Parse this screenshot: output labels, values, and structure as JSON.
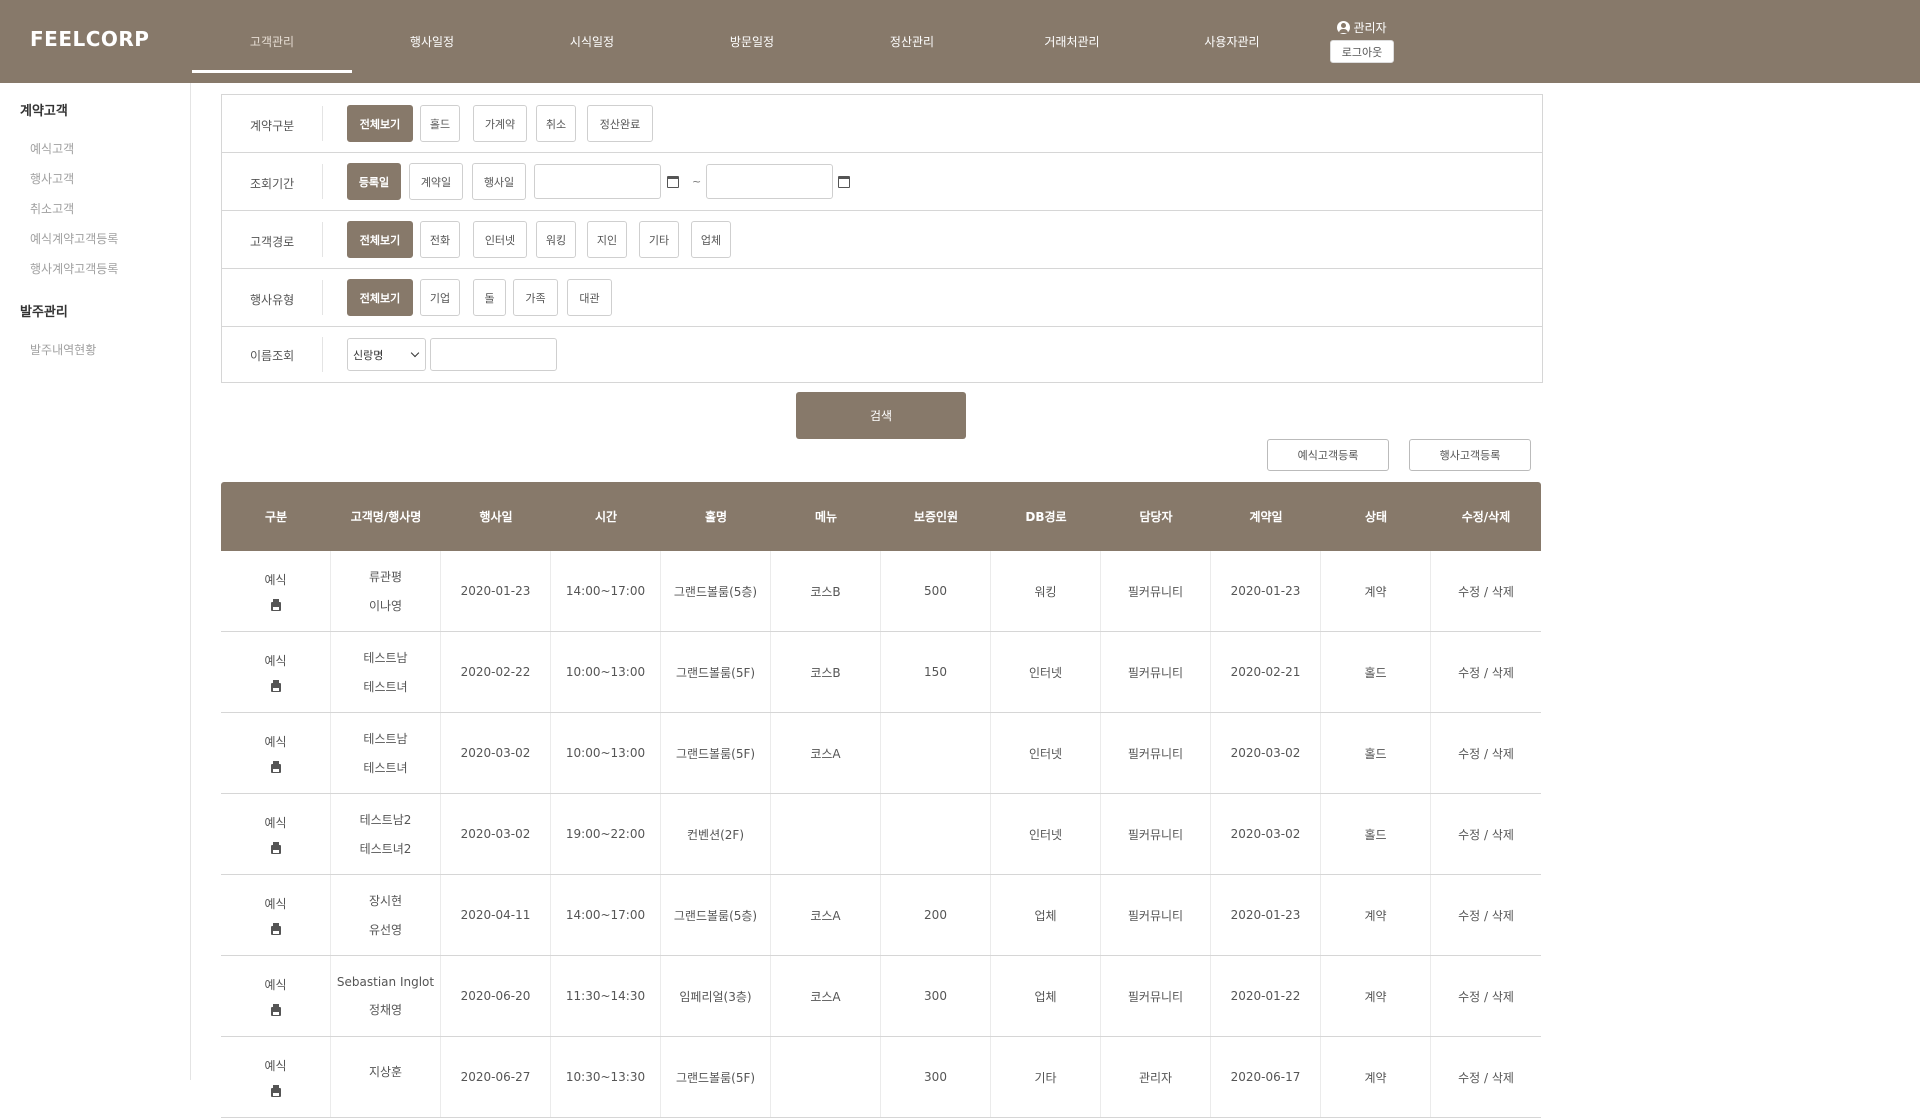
{
  "header": {
    "logo": "FEELCORP",
    "nav": [
      "고객관리",
      "행사일정",
      "시식일정",
      "방문일정",
      "정산관리",
      "거래처관리",
      "사용자관리"
    ],
    "active_nav": "고객관리",
    "user": "관리자",
    "logout": "로그아웃"
  },
  "sidebar": {
    "groups": [
      {
        "title": "계약고객",
        "items": [
          "예식고객",
          "행사고객",
          "취소고객",
          "예식계약고객등록",
          "행사계약고객등록"
        ]
      },
      {
        "title": "발주관리",
        "items": [
          "발주내역현황"
        ]
      }
    ]
  },
  "filters": {
    "contract_type": {
      "label": "계약구분",
      "options": [
        "전체보기",
        "홀드",
        "가계약",
        "취소",
        "정산완료"
      ],
      "selected": "전체보기"
    },
    "period": {
      "label": "조회기간",
      "options": [
        "등록일",
        "계약일",
        "행사일"
      ],
      "selected": "등록일",
      "from": "",
      "to": "",
      "separator": "~"
    },
    "route": {
      "label": "고객경로",
      "options": [
        "전체보기",
        "전화",
        "인터넷",
        "워킹",
        "지인",
        "기타",
        "업체"
      ],
      "selected": "전체보기"
    },
    "event_type": {
      "label": "행사유형",
      "options": [
        "전체보기",
        "기업",
        "돌",
        "가족",
        "대관"
      ],
      "selected": "전체보기"
    },
    "name_search": {
      "label": "이름조회",
      "select_value": "신랑명",
      "input_value": ""
    }
  },
  "actions": {
    "search": "검색",
    "register_wedding": "예식고객등록",
    "register_event": "행사고객등록"
  },
  "table": {
    "columns": [
      "구분",
      "고객명/행사명",
      "행사일",
      "시간",
      "홀명",
      "메뉴",
      "보증인원",
      "DB경로",
      "담당자",
      "계약일",
      "상태",
      "수정/삭제"
    ],
    "rows": [
      {
        "type": "예식",
        "name1": "류관평",
        "name2": "이나영",
        "date": "2020-01-23",
        "time": "14:00~17:00",
        "hall": "그랜드볼룸(5층)",
        "menu": "코스B",
        "guests": "500",
        "route": "워킹",
        "manager": "필커뮤니티",
        "contract_date": "2020-01-23",
        "status": "계약",
        "action": "수정 / 삭제"
      },
      {
        "type": "예식",
        "name1": "테스트남",
        "name2": "테스트녀",
        "date": "2020-02-22",
        "time": "10:00~13:00",
        "hall": "그랜드볼룸(5F)",
        "menu": "코스B",
        "guests": "150",
        "route": "인터넷",
        "manager": "필커뮤니티",
        "contract_date": "2020-02-21",
        "status": "홀드",
        "action": "수정 / 삭제"
      },
      {
        "type": "예식",
        "name1": "테스트남",
        "name2": "테스트녀",
        "date": "2020-03-02",
        "time": "10:00~13:00",
        "hall": "그랜드볼룸(5F)",
        "menu": "코스A",
        "guests": "",
        "route": "인터넷",
        "manager": "필커뮤니티",
        "contract_date": "2020-03-02",
        "status": "홀드",
        "action": "수정 / 삭제"
      },
      {
        "type": "예식",
        "name1": "테스트남2",
        "name2": "테스트녀2",
        "date": "2020-03-02",
        "time": "19:00~22:00",
        "hall": "컨벤션(2F)",
        "menu": "",
        "guests": "",
        "route": "인터넷",
        "manager": "필커뮤니티",
        "contract_date": "2020-03-02",
        "status": "홀드",
        "action": "수정 / 삭제"
      },
      {
        "type": "예식",
        "name1": "장시현",
        "name2": "유선영",
        "date": "2020-04-11",
        "time": "14:00~17:00",
        "hall": "그랜드볼룸(5층)",
        "menu": "코스A",
        "guests": "200",
        "route": "업체",
        "manager": "필커뮤니티",
        "contract_date": "2020-01-23",
        "status": "계약",
        "action": "수정 / 삭제"
      },
      {
        "type": "예식",
        "name1": "Sebastian Inglot",
        "name2": "정채영",
        "date": "2020-06-20",
        "time": "11:30~14:30",
        "hall": "임페리얼(3층)",
        "menu": "코스A",
        "guests": "300",
        "route": "업체",
        "manager": "필커뮤니티",
        "contract_date": "2020-01-22",
        "status": "계약",
        "action": "수정 / 삭제"
      },
      {
        "type": "예식",
        "name1": "지상훈",
        "name2": "",
        "date": "2020-06-27",
        "time": "10:30~13:30",
        "hall": "그랜드볼룸(5F)",
        "menu": "",
        "guests": "300",
        "route": "기타",
        "manager": "관리자",
        "contract_date": "2020-06-17",
        "status": "계약",
        "action": "수정 / 삭제"
      }
    ]
  }
}
